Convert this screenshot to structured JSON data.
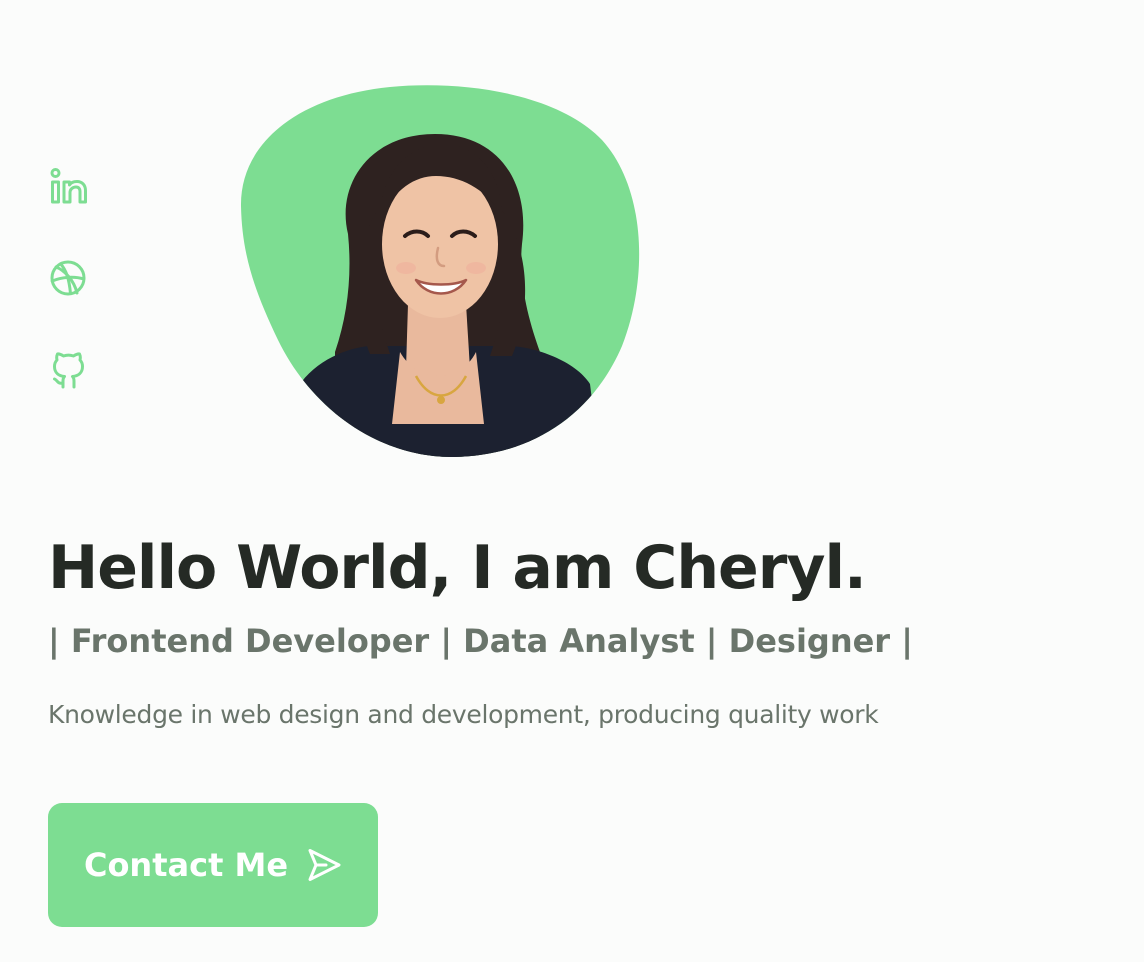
{
  "social": {
    "items": [
      {
        "name": "linkedin",
        "icon": "linkedin-icon"
      },
      {
        "name": "dribbble",
        "icon": "dribbble-icon"
      },
      {
        "name": "github",
        "icon": "github-icon"
      }
    ]
  },
  "hero": {
    "headline": "Hello World, I am Cheryl.",
    "subtitle": "| Frontend Developer | Data Analyst | Designer |",
    "description": "Knowledge in web design and development, producing quality work",
    "cta_label": "Contact Me",
    "cta_icon": "send-icon"
  },
  "colors": {
    "accent": "#7ddd92",
    "heading": "#252a25",
    "muted": "#6a756b",
    "background": "#fbfcfb"
  }
}
